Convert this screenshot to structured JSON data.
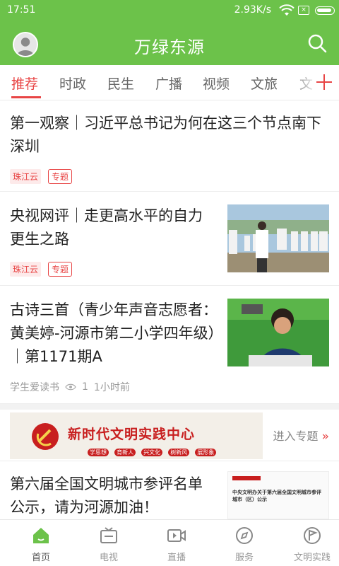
{
  "status_bar": {
    "time": "17:51",
    "net_speed": "2.93K/s",
    "sim_label": "×"
  },
  "header": {
    "title": "万绿东源"
  },
  "tabs": [
    {
      "label": "推荐"
    },
    {
      "label": "时政"
    },
    {
      "label": "民生"
    },
    {
      "label": "广播"
    },
    {
      "label": "视频"
    },
    {
      "label": "文旅"
    },
    {
      "label": "文"
    }
  ],
  "articles": [
    {
      "title": "第一观察｜习近平总书记为何在这三个节点南下深圳",
      "source": "珠江云",
      "topic": "专题"
    },
    {
      "title": "央视网评｜走更高水平的自力更生之路",
      "source": "珠江云",
      "topic": "专题"
    },
    {
      "title": "古诗三首（青少年声音志愿者：黄美婷-河源市第二小学四年级）｜第1171期A",
      "author": "学生爱读书",
      "views": "1",
      "time": "1小时前"
    },
    {
      "title": "第六届全国文明城市参评名单公示，请为河源加油！",
      "thumb_text": "中央文明办关于第六届全国文明城市参评城市（区）公示"
    }
  ],
  "banner": {
    "prefix": "新时代",
    "main": "文明实践中心",
    "pills": [
      "学思想",
      "育新人",
      "兴文化",
      "树新风",
      "展形象"
    ],
    "link": "进入专题",
    "link_icon": "»"
  },
  "bottom_nav": [
    {
      "label": "首页"
    },
    {
      "label": "电视"
    },
    {
      "label": "直播"
    },
    {
      "label": "服务"
    },
    {
      "label": "文明实践"
    }
  ],
  "colors": {
    "brand_green": "#6cc24a",
    "accent_red": "#e84545"
  }
}
